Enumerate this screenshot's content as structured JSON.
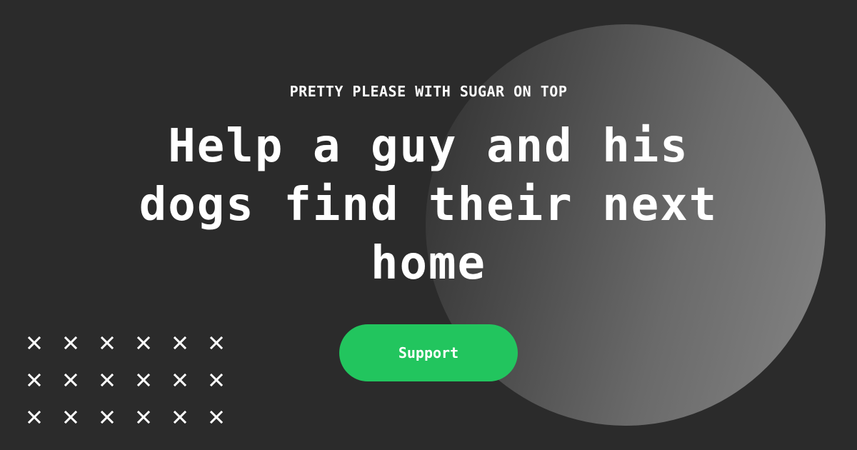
{
  "hero": {
    "eyebrow": "PRETTY PLEASE WITH SUGAR ON TOP",
    "headline": "Help a guy and his dogs find their next home",
    "cta_label": "Support"
  },
  "decor": {
    "x_pattern": {
      "icon": "x-mark-icon",
      "rows": 3,
      "columns": 6
    }
  },
  "colors": {
    "background": "#2b2b2b",
    "accent_green": "#22c55e",
    "text": "#ffffff"
  }
}
